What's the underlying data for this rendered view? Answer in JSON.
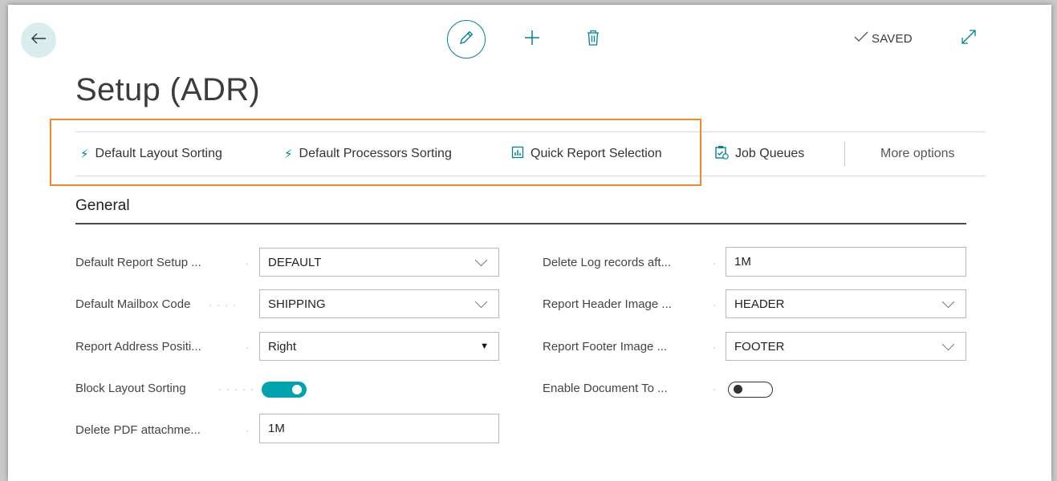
{
  "header": {
    "saved_label": "SAVED",
    "page_title": "Setup (ADR)"
  },
  "actions": [
    {
      "label": "Default Layout Sorting",
      "icon": "lightning-icon"
    },
    {
      "label": "Default Processors Sorting",
      "icon": "lightning-icon"
    },
    {
      "label": "Quick Report Selection",
      "icon": "report-icon"
    },
    {
      "label": "Job Queues",
      "icon": "job-queue-icon"
    },
    {
      "label": "More options"
    }
  ],
  "section": {
    "title": "General"
  },
  "left_fields": [
    {
      "label": "Default Report Setup ...",
      "value": "DEFAULT",
      "type": "dropdown"
    },
    {
      "label": "Default Mailbox Code",
      "value": "SHIPPING",
      "type": "dropdown"
    },
    {
      "label": "Report Address Positi...",
      "value": "Right",
      "type": "select"
    },
    {
      "label": "Block Layout Sorting",
      "value": "on",
      "type": "toggle"
    },
    {
      "label": "Delete PDF attachme...",
      "value": "1M",
      "type": "text"
    }
  ],
  "right_fields": [
    {
      "label": "Delete Log records aft...",
      "value": "1M",
      "type": "text"
    },
    {
      "label": "Report Header Image ...",
      "value": "HEADER",
      "type": "dropdown"
    },
    {
      "label": "Report Footer Image ...",
      "value": "FOOTER",
      "type": "dropdown"
    },
    {
      "label": "Enable Document To ...",
      "value": "off",
      "type": "toggle"
    }
  ],
  "colors": {
    "accent": "#00838f",
    "toggle_on": "#00a2ad",
    "highlight_box": "#f28c28"
  }
}
